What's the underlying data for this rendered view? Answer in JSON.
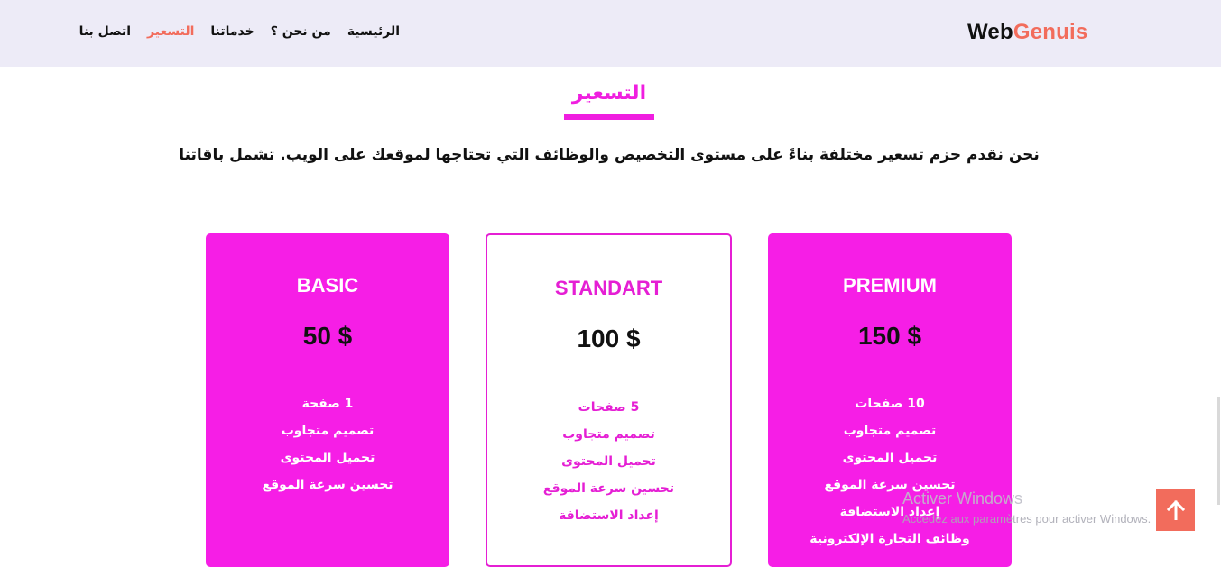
{
  "brand": {
    "part1": "Web",
    "part2": "Genuis",
    "accent_color": "#f26c5c"
  },
  "nav": {
    "items": [
      {
        "label": "الرئيسية",
        "active": false
      },
      {
        "label": "من نحن ؟",
        "active": false
      },
      {
        "label": "خدماتنا",
        "active": false
      },
      {
        "label": "التسعير",
        "active": true
      },
      {
        "label": "اتصل بنا",
        "active": false
      }
    ]
  },
  "section": {
    "title": "التسعير",
    "intro": "نحن نقدم حزم تسعير مختلفة بناءً على مستوى التخصيص والوظائف التي تحتاجها لموقعك على الويب. تشمل باقاتنا"
  },
  "plans": [
    {
      "name": "BASIC",
      "price": "50 $",
      "features": [
        "1 صفحة",
        "تصميم متجاوب",
        "تحميل المحتوى",
        "تحسين سرعة الموقع"
      ]
    },
    {
      "name": "STANDART",
      "price": "100 $",
      "features": [
        "5 صفحات",
        "تصميم متجاوب",
        "تحميل المحتوى",
        "تحسين سرعة الموقع",
        "إعداد الاستضافة"
      ]
    },
    {
      "name": "PREMIUM",
      "price": "150 $",
      "features": [
        "10 صفحات",
        "تصميم متجاوب",
        "تحميل المحتوى",
        "تحسين سرعة الموقع",
        "إعداد الاستضافة",
        "وظائف التجارة الإلكترونية"
      ]
    }
  ],
  "colors": {
    "primary": "#f61ee6",
    "accent": "#f26c5c",
    "nav_bg": "#edebf7"
  },
  "windows_watermark": {
    "title": "Activer Windows",
    "subtitle": "Accédez aux paramètres pour activer Windows."
  },
  "scroll_top": {
    "icon": "arrow-up-icon"
  }
}
